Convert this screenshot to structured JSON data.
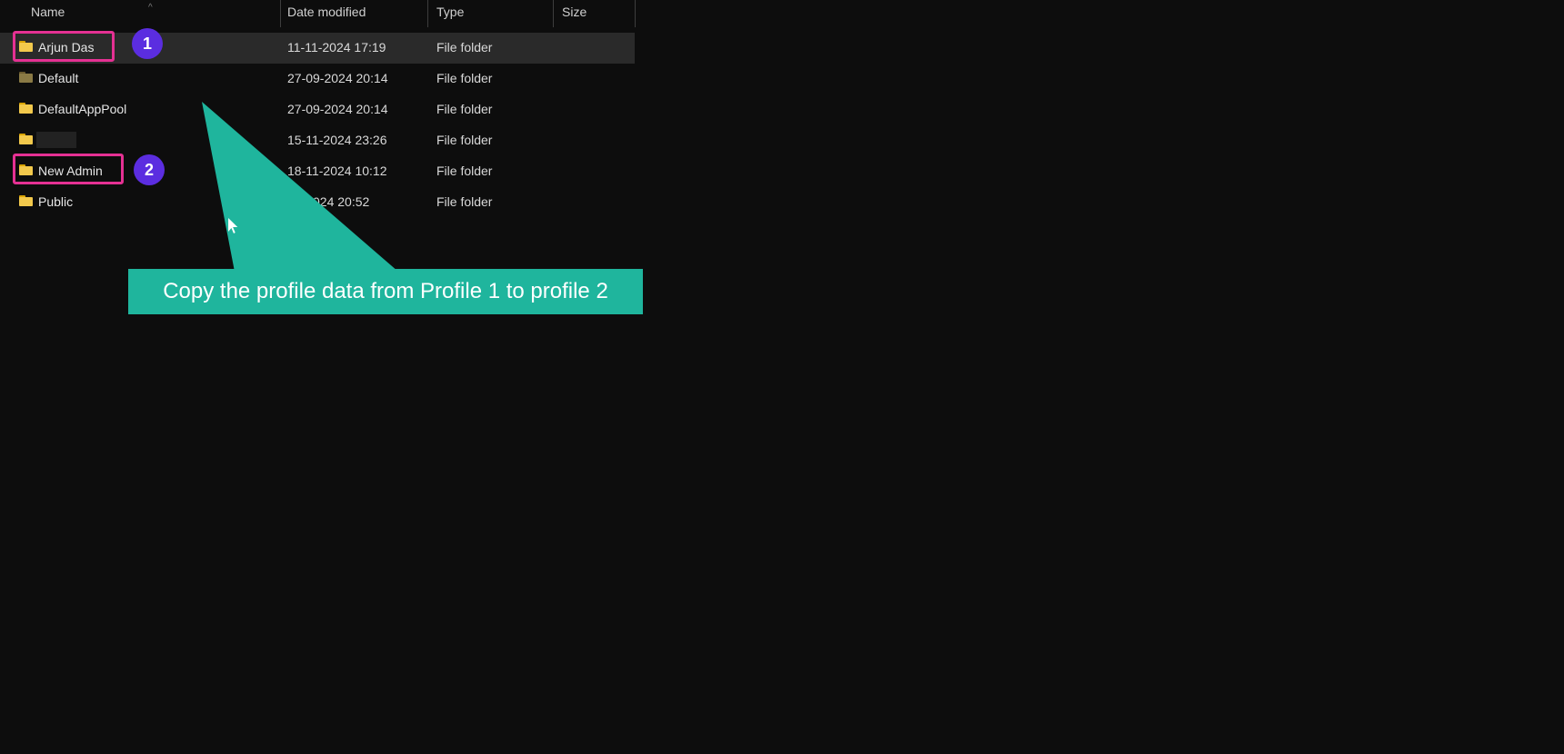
{
  "header": {
    "columns": {
      "name": "Name",
      "date": "Date modified",
      "type": "Type",
      "size": "Size"
    },
    "sort_indicator": "^"
  },
  "rows": [
    {
      "name": "Arjun Das",
      "date": "11-11-2024 17:19",
      "type": "File folder",
      "selected": true,
      "icon": "yellow",
      "redacted": false
    },
    {
      "name": "Default",
      "date": "27-09-2024 20:14",
      "type": "File folder",
      "selected": false,
      "icon": "dim",
      "redacted": false
    },
    {
      "name": "DefaultAppPool",
      "date": "27-09-2024 20:14",
      "type": "File folder",
      "selected": false,
      "icon": "yellow",
      "redacted": false
    },
    {
      "name": "",
      "date": "15-11-2024 23:26",
      "type": "File folder",
      "selected": false,
      "icon": "yellow",
      "redacted": true
    },
    {
      "name": "New Admin",
      "date": "18-11-2024 10:12",
      "type": "File folder",
      "selected": false,
      "icon": "yellow",
      "redacted": false
    },
    {
      "name": "Public",
      "date": "09-2024 20:52",
      "type": "File folder",
      "selected": false,
      "icon": "yellow",
      "redacted": false
    }
  ],
  "annotations": {
    "badge1": "1",
    "badge2": "2",
    "callout_text": "Copy the profile data from Profile 1 to profile 2"
  },
  "colors": {
    "highlight_border": "#e53193",
    "badge_bg": "#5b2de0",
    "callout_bg": "#1fb59d"
  }
}
